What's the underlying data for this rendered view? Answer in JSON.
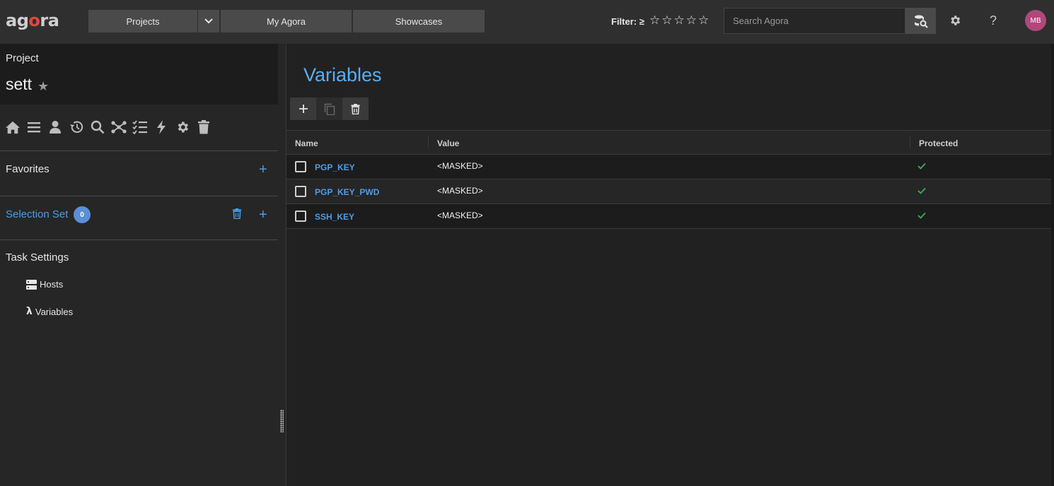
{
  "header": {
    "logo_prefix": "ag",
    "logo_o": "o",
    "logo_suffix": "ra",
    "nav": {
      "projects": "Projects",
      "my_agora": "My Agora",
      "showcases": "Showcases"
    },
    "filter_label": "Filter: ≥",
    "stars": [
      "☆",
      "☆",
      "☆",
      "☆",
      "☆"
    ],
    "search_placeholder": "Search Agora",
    "help": "?",
    "avatar_initials": "MB"
  },
  "sidebar": {
    "project_label": "Project",
    "project_name": "sett",
    "favorites": "Favorites",
    "selection_set": "Selection Set",
    "selection_count": "0",
    "task_settings": "Task Settings",
    "items": [
      {
        "label": "Hosts"
      },
      {
        "label": "Variables"
      }
    ]
  },
  "main": {
    "title": "Variables",
    "columns": {
      "name": "Name",
      "value": "Value",
      "protected": "Protected"
    },
    "rows": [
      {
        "name": "PGP_KEY",
        "value": "<MASKED>",
        "protected": true
      },
      {
        "name": "PGP_KEY_PWD",
        "value": "<MASKED>",
        "protected": true
      },
      {
        "name": "SSH_KEY",
        "value": "<MASKED>",
        "protected": true
      }
    ]
  },
  "colors": {
    "accent": "#4a9ee8",
    "title": "#5aaef0",
    "check": "#3fae5a",
    "avatar": "#b0487a",
    "logo_o": "#e0483e"
  }
}
